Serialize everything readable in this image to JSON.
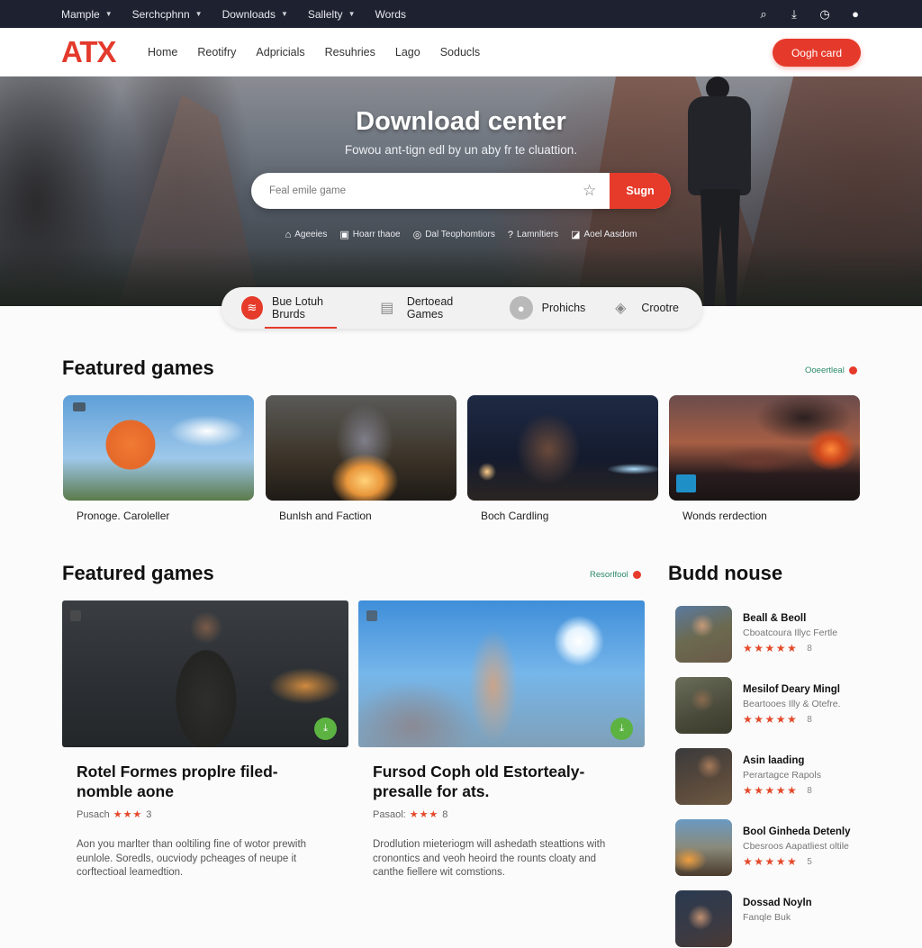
{
  "topbar": {
    "menu": [
      {
        "label": "Mample",
        "has_dropdown": true
      },
      {
        "label": "Serchcphnn",
        "has_dropdown": true
      },
      {
        "label": "Downloads",
        "has_dropdown": true
      },
      {
        "label": "Sallelty",
        "has_dropdown": true
      },
      {
        "label": "Words",
        "has_dropdown": false
      }
    ],
    "icons": [
      "search-icon",
      "download-icon",
      "clock-icon",
      "globe-icon"
    ],
    "icon_glyphs": {
      "search": "⌕",
      "download": "⤓",
      "clock": "◷",
      "globe": "●"
    }
  },
  "navbar": {
    "logo": "ATX",
    "links": [
      "Home",
      "Reotifry",
      "Adpricials",
      "Resuhries",
      "Lago",
      "Soducls"
    ],
    "cta_label": "Oogh card"
  },
  "hero": {
    "title": "Download center",
    "subtitle": "Fowou ant-tign edl by un aby fr te cluattion.",
    "search": {
      "placeholder": "Feal emile game",
      "value": "",
      "button_label": "Sugn",
      "star_glyph": "☆"
    },
    "quick_links": [
      {
        "icon": "gift-icon",
        "glyph": "⌂",
        "label": "Ageeies"
      },
      {
        "icon": "mail-icon",
        "glyph": "▣",
        "label": "Hoarr thaoe"
      },
      {
        "icon": "settings-icon",
        "glyph": "◎",
        "label": "Dal Teophomtiors"
      },
      {
        "icon": "help-icon",
        "glyph": "?",
        "label": "Lamnltiers"
      },
      {
        "icon": "chat-icon",
        "glyph": "◪",
        "label": "Aoel Aasdom"
      }
    ]
  },
  "tabs": [
    {
      "label": "Bue Lotuh Brurds",
      "icon": "feed-icon",
      "glyph": "≋",
      "active": true
    },
    {
      "label": "Dertoead Games",
      "icon": "gamebox-icon",
      "glyph": "▤",
      "active": false
    },
    {
      "label": "Prohichs",
      "icon": "profile-icon",
      "glyph": "●",
      "active": false
    },
    {
      "label": "Crootre",
      "icon": "share-icon",
      "glyph": "◈",
      "active": false
    }
  ],
  "featured_top": {
    "title": "Featured games",
    "see_all": "Ooeertleal",
    "cards": [
      {
        "title": "Pronoge. Caroleller"
      },
      {
        "title": "Bunlsh and Faction"
      },
      {
        "title": "Boch Cardling"
      },
      {
        "title": "Wonds rerdection"
      }
    ]
  },
  "featured_bottom": {
    "title": "Featured games",
    "see_all": "Resorlfool",
    "cards": [
      {
        "title": "Rotel Formes proplre filed-nomble aone",
        "rating_label": "Pusach",
        "stars": 3,
        "star_text": "★★★",
        "count": "3",
        "description": "Aon you marlter than ooltiling fine of wotor prewith eunlole. Soredls, oucviody pcheages of neupe it corftectioal leamedtion."
      },
      {
        "title": "Fursod Coph old Estortealy-presalle for ats.",
        "rating_label": "Pasaol:",
        "stars": 3,
        "star_text": "★★★",
        "count": "8",
        "description": "Drodlution mieteriogm will ashedath steattions with cronontics and veoh heoird the rounts cloaty and canthe fiellere wit comstions."
      }
    ]
  },
  "sidebar": {
    "title": "Budd nouse",
    "items": [
      {
        "name": "Beall & Beoll",
        "subtitle": "Cboatcoura Illyc Fertle",
        "stars": 5,
        "star_text": "★★★★★",
        "count": "8"
      },
      {
        "name": "Mesilof Deary Mingl",
        "subtitle": "Beartooes Illy & Otefre.",
        "stars": 5,
        "star_text": "★★★★★",
        "count": "8"
      },
      {
        "name": "Asin laading",
        "subtitle": "Perartagce Rapols",
        "stars": 5,
        "star_text": "★★★★★",
        "count": "8"
      },
      {
        "name": "Bool Ginheda Detenly",
        "subtitle": "Cbesroos Aapatliest oltile",
        "stars": 5,
        "star_text": "★★★★★",
        "count": "5"
      },
      {
        "name": "Dossad Noyln",
        "subtitle": "Fanqle Buk",
        "stars": null,
        "star_text": "",
        "count": ""
      }
    ]
  },
  "colors": {
    "accent": "#e63a2a",
    "topbar_bg": "#1e2230",
    "link_green": "#2c8a6a",
    "download_badge": "#5cb342",
    "star": "#e4492a"
  }
}
